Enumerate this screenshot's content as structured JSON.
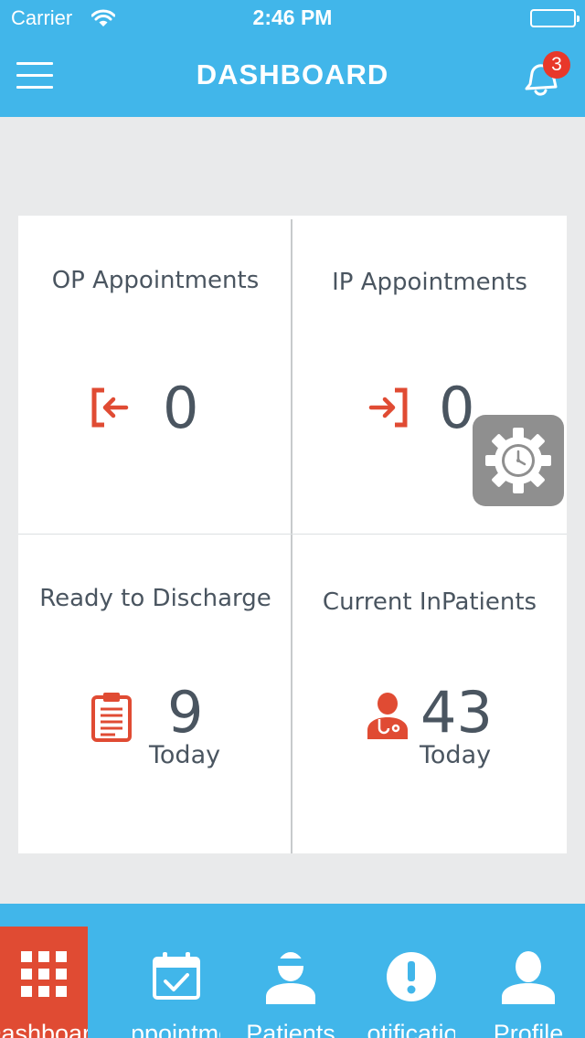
{
  "status_bar": {
    "carrier": "Carrier",
    "time": "2:46 PM"
  },
  "nav": {
    "title": "DASHBOARD",
    "notification_count": "3"
  },
  "cards": [
    {
      "title": "OP Appointments",
      "value": "0",
      "icon": "exit-arrow-icon",
      "accent": "#e04b33"
    },
    {
      "title": "IP Appointments",
      "value": "0",
      "icon": "enter-arrow-icon",
      "accent": "#e04b33"
    },
    {
      "title": "Ready to Discharge",
      "value": "9",
      "sub": "Today",
      "icon": "clipboard-icon",
      "accent": "#e04b33"
    },
    {
      "title": "Current InPatients",
      "value": "43",
      "sub": "Today",
      "icon": "doctor-icon",
      "accent": "#e04b33"
    }
  ],
  "floating_button": {
    "icon": "gear-clock-icon"
  },
  "tabs": [
    {
      "label": "Dashboard",
      "icon": "grid-icon",
      "active": true
    },
    {
      "label": "Appointments",
      "icon": "calendar-check-icon",
      "active": false
    },
    {
      "label": "Patients",
      "icon": "patient-icon",
      "active": false
    },
    {
      "label": "Notifications",
      "icon": "alert-icon",
      "active": false
    },
    {
      "label": "Profile",
      "icon": "user-icon",
      "active": false
    }
  ],
  "colors": {
    "primary": "#41b6ea",
    "accent": "#e04b33",
    "background": "#e9eaeb",
    "text": "#4a5560",
    "fab": "#8f8f8f"
  }
}
